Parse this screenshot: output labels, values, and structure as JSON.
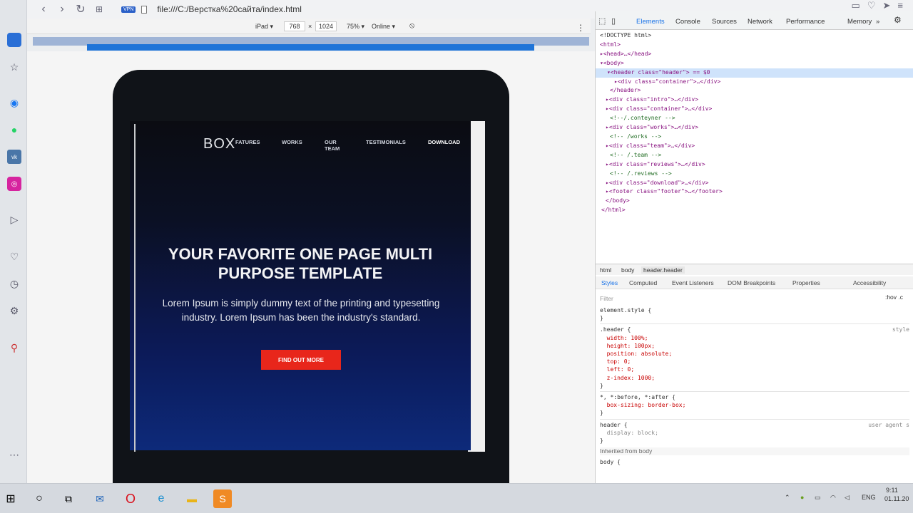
{
  "browser": {
    "url": "file:///C:/Верстка%20сайта/index.html",
    "vpn_label": "VPN"
  },
  "device_toolbar": {
    "device": "iPad ▾",
    "width": "768",
    "times": "×",
    "height": "1024",
    "zoom": "75% ▾",
    "network": "Online ▾"
  },
  "site": {
    "logo": "BOX",
    "nav": [
      "FATURES",
      "WORKS",
      "OUR TEAM",
      "TESTIMONIALS",
      "DOWNLOAD"
    ],
    "hero_title": "YOUR FAVORITE ONE PAGE MULTI PURPOSE TEMPLATE",
    "hero_text": "Lorem Ipsum is simply dummy text of the printing and typesetting industry. Lorem Ipsum has been the industry's standard.",
    "cta": "FIND OUT MORE"
  },
  "devtools": {
    "tabs": [
      "Elements",
      "Console",
      "Sources",
      "Network",
      "Performance",
      "Memory",
      "»"
    ],
    "dom": [
      "<!DOCTYPE html>",
      "<html>",
      "▸<head>…</head>",
      "▾<body>",
      "▾<header class=\"header\"> == $0",
      "▸<div class=\"container\">…</div>",
      "</header>",
      "▸<div class=\"intro\">…</div>",
      "▸<div class=\"container\">…</div>",
      "<!--/.conteyner -->",
      "▸<div class=\"works\">…</div>",
      "<!-- /works -->",
      "▸<div class=\"team\">…</div>",
      "<!-- /.team -->",
      "▸<div class=\"reviews\">…</div>",
      "<!-- /.reviews -->",
      "▸<div class=\"download\">…</div>",
      "▸<footer class=\"footer\">…</footer>",
      "</body>",
      "</html>"
    ],
    "breadcrumbs": [
      "html",
      "body",
      "header.header"
    ],
    "style_tabs": [
      "Styles",
      "Computed",
      "Event Listeners",
      "DOM Breakpoints",
      "Properties",
      "Accessibility"
    ],
    "filter": "Filter",
    "hov": ":hov .c",
    "rules": [
      "element.style {",
      "}",
      ".header {",
      "  width: 100%;",
      "  height: 100px;",
      "  position: absolute;",
      "  top: 0;",
      "  left: 0;",
      "  z-index: 1000;",
      "}",
      "*, *:before, *:after {",
      "  box-sizing: border-box;",
      "}",
      "header {",
      "  display: block;",
      "}"
    ],
    "inherited": "Inherited from body",
    "body_rule": "body {",
    "src_style": "style",
    "src_user_agent": "user agent s"
  },
  "taskbar": {
    "lang": "ENG",
    "time": "9:11",
    "date": "01.11.20"
  }
}
